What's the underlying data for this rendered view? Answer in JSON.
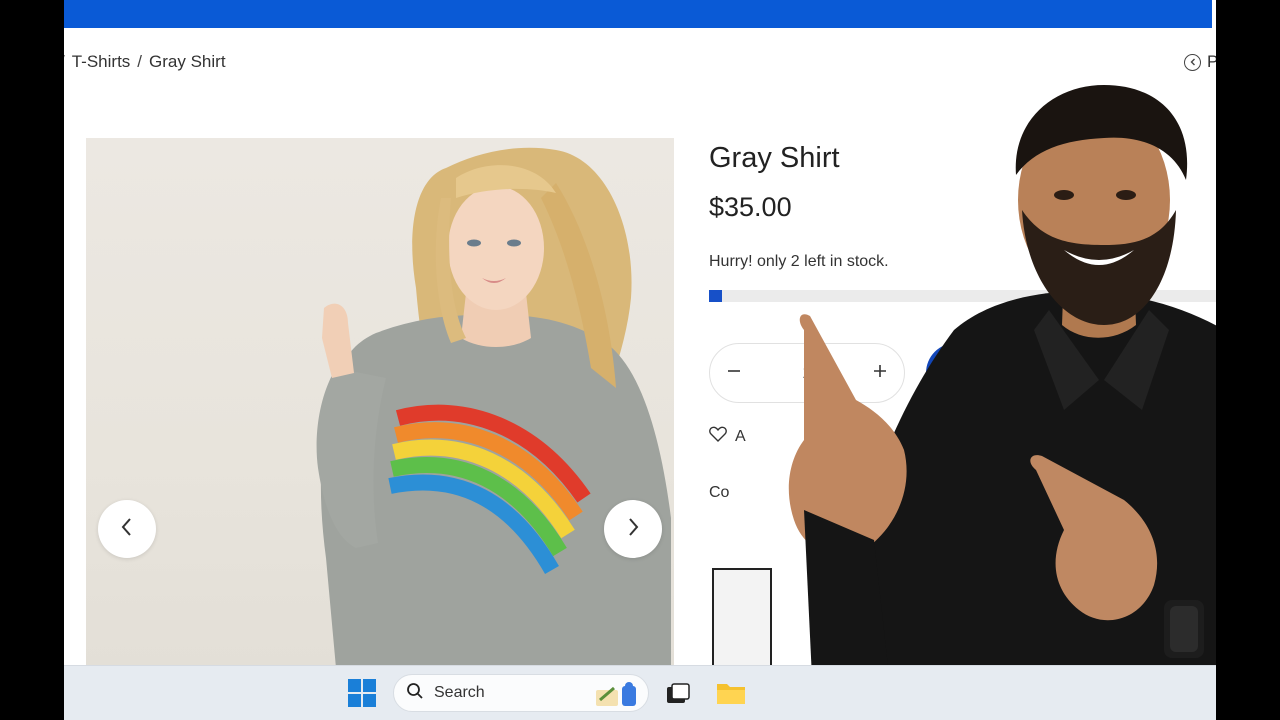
{
  "breadcrumb": {
    "items": [
      "T-Shirts",
      "Gray Shirt"
    ],
    "separator": "/"
  },
  "prev_link": {
    "label": "P"
  },
  "product": {
    "title": "Gray Shirt",
    "price": "$35.00",
    "stock_message": "Hurry! only 2 left in stock.",
    "stock_level_fraction": 0.025,
    "quantity": "1",
    "wishlist_label": "A",
    "compare_label": "Co"
  },
  "gallery": {
    "prev_icon": "chevron-left-icon",
    "next_icon": "chevron-right-icon"
  },
  "taskbar": {
    "search_label": "Search"
  },
  "colors": {
    "top_bar": "#0a5ad6",
    "stock_fill": "#1750c8",
    "add_button": "#1246b8"
  }
}
